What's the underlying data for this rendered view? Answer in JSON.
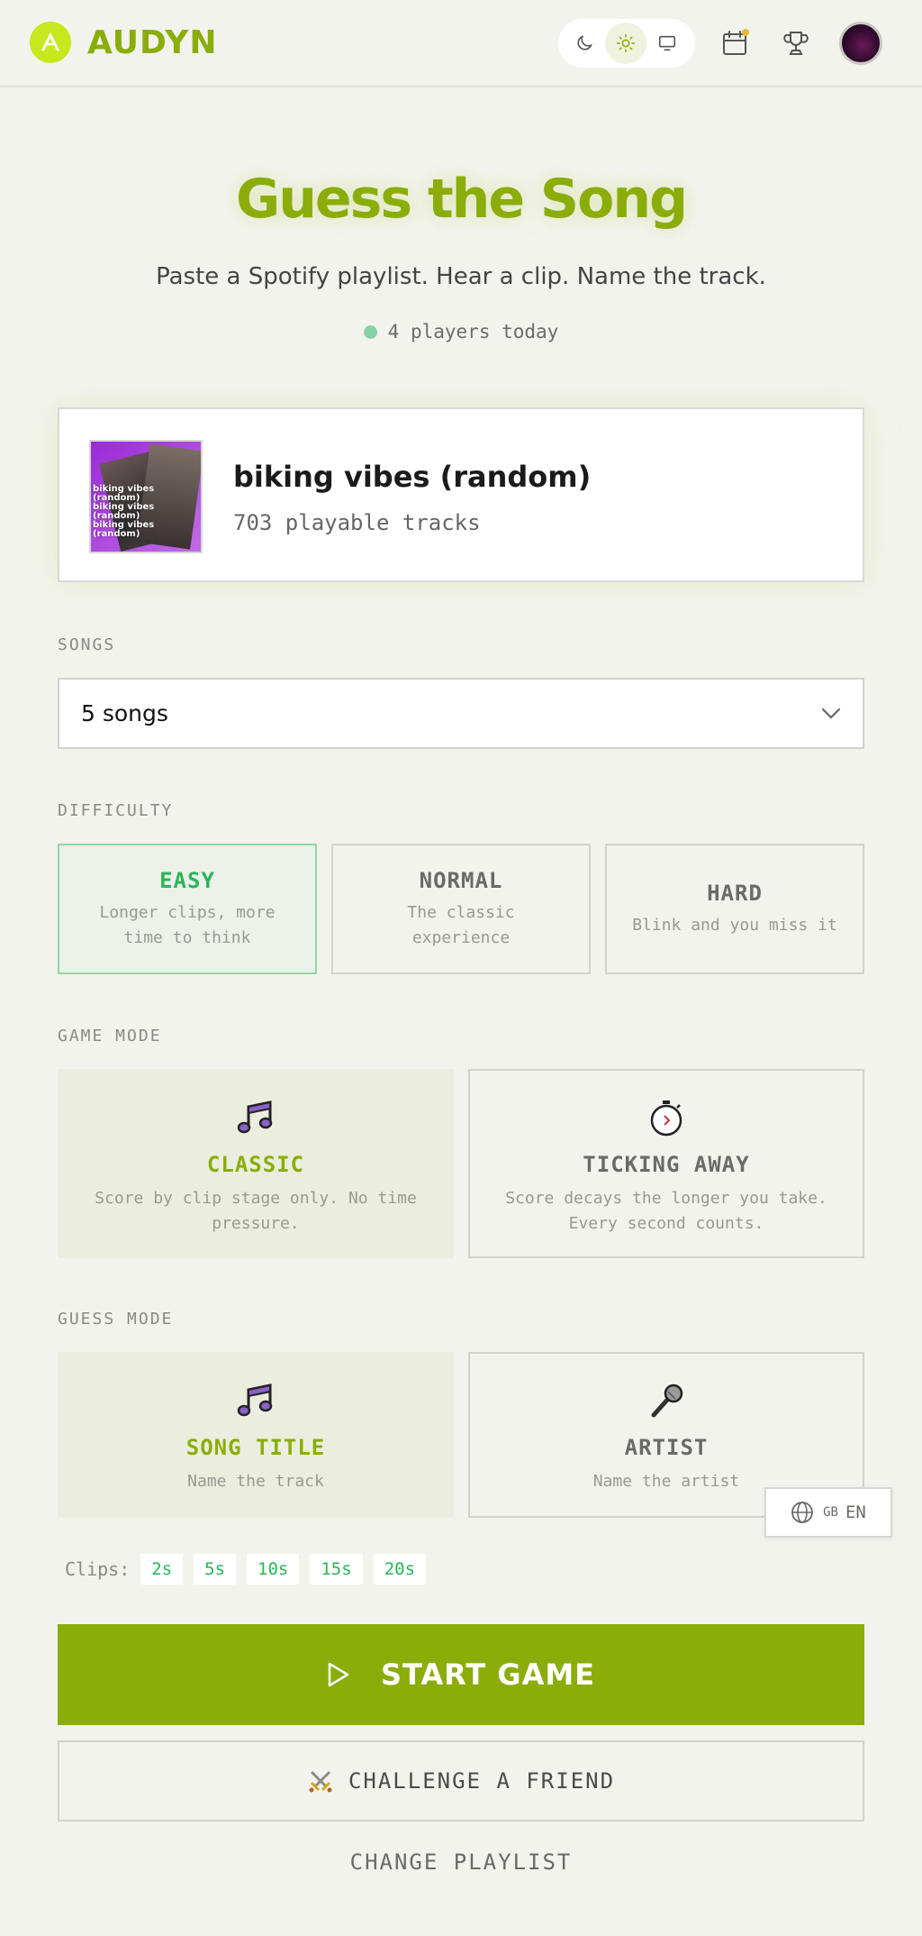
{
  "header": {
    "brand": "AUDYN",
    "icons": {
      "logo": "audyn-logo-icon",
      "dark": "moon-icon",
      "light": "sun-icon",
      "system": "monitor-icon",
      "calendar": "calendar-icon",
      "trophy": "trophy-icon"
    },
    "active_theme": "light"
  },
  "hero": {
    "title": "Guess the Song",
    "subtitle": "Paste a Spotify playlist. Hear a clip. Name the track.",
    "players": "4 players today"
  },
  "playlist": {
    "name": "biking vibes (random)",
    "tracks": "703 playable tracks",
    "cover_text": "biking vibes (random)"
  },
  "songs": {
    "label": "SONGS",
    "selected": "5 songs"
  },
  "difficulty": {
    "label": "DIFFICULTY",
    "options": [
      {
        "title": "EASY",
        "desc": "Longer clips, more time to think",
        "active": true
      },
      {
        "title": "NORMAL",
        "desc": "The classic experience",
        "active": false
      },
      {
        "title": "HARD",
        "desc": "Blink and you miss it",
        "active": false
      }
    ]
  },
  "game_mode": {
    "label": "GAME MODE",
    "options": [
      {
        "title": "CLASSIC",
        "desc": "Score by clip stage only. No time pressure.",
        "icon": "music-note-icon",
        "active": true
      },
      {
        "title": "TICKING AWAY",
        "desc": "Score decays the longer you take. Every second counts.",
        "icon": "stopwatch-icon",
        "active": false
      }
    ]
  },
  "guess_mode": {
    "label": "GUESS MODE",
    "options": [
      {
        "title": "SONG TITLE",
        "desc": "Name the track",
        "icon": "music-note-icon",
        "active": true
      },
      {
        "title": "ARTIST",
        "desc": "Name the artist",
        "icon": "microphone-icon",
        "active": false
      }
    ]
  },
  "clips": {
    "label": "Clips:",
    "values": [
      "2s",
      "5s",
      "10s",
      "15s",
      "20s"
    ]
  },
  "language": {
    "flag": "GB",
    "code": "EN"
  },
  "actions": {
    "start": "START GAME",
    "challenge": "CHALLENGE A FRIEND",
    "change": "CHANGE PLAYLIST"
  },
  "colors": {
    "accent": "#8aad0a",
    "easy_green": "#2ab55a",
    "background": "#f3f3ee"
  }
}
